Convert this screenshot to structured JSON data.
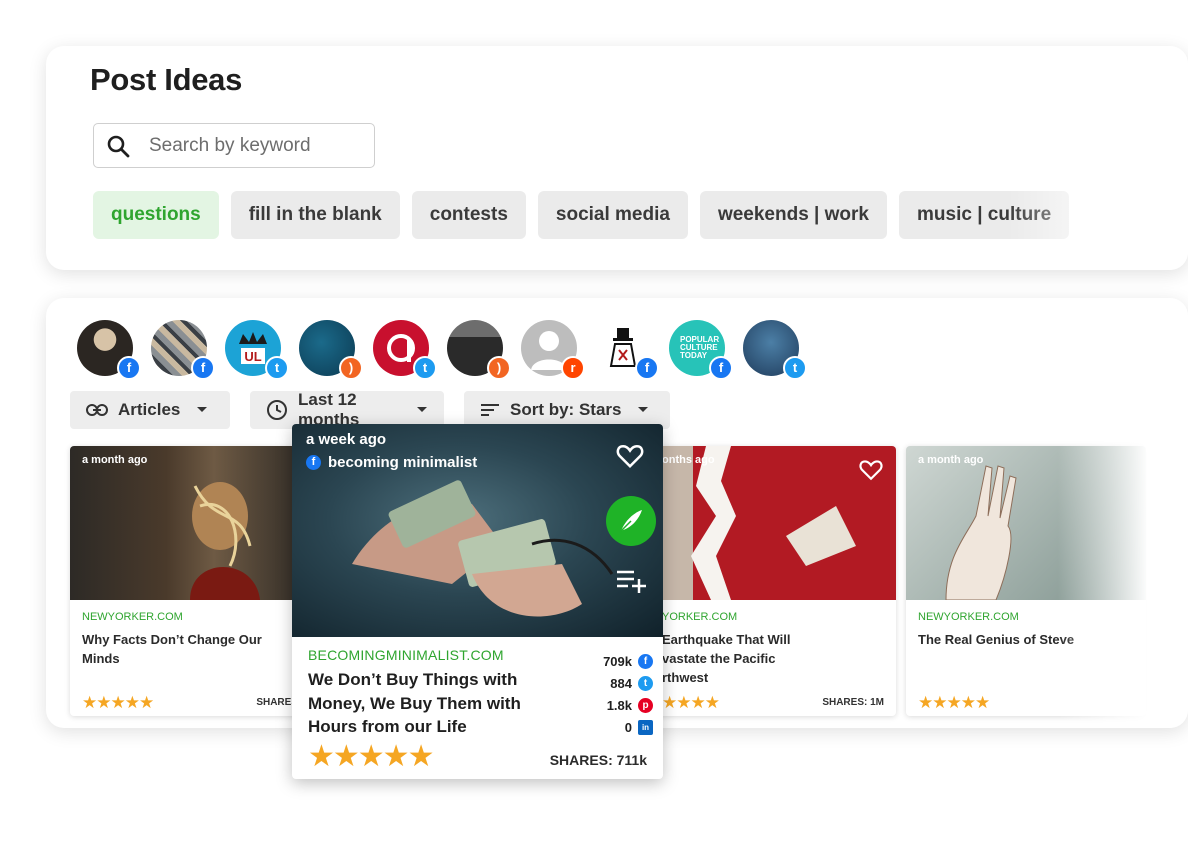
{
  "header": {
    "title": "Post Ideas",
    "search_placeholder": "Search by keyword"
  },
  "chips": [
    {
      "label": "questions",
      "active": true
    },
    {
      "label": "fill in the blank",
      "active": false
    },
    {
      "label": "contests",
      "active": false
    },
    {
      "label": "social media",
      "active": false
    },
    {
      "label": "weekends | work",
      "active": false
    },
    {
      "label": "music | culture",
      "active": false
    }
  ],
  "sources": [
    {
      "network": "facebook",
      "icon": "facebook-icon"
    },
    {
      "network": "facebook",
      "icon": "facebook-icon"
    },
    {
      "network": "twitter",
      "icon": "twitter-icon"
    },
    {
      "network": "rss",
      "icon": "rss-icon"
    },
    {
      "network": "twitter",
      "icon": "twitter-icon"
    },
    {
      "network": "rss",
      "icon": "rss-icon"
    },
    {
      "network": "reddit",
      "icon": "reddit-icon"
    },
    {
      "network": "facebook",
      "icon": "facebook-icon"
    },
    {
      "network": "facebook",
      "icon": "facebook-icon",
      "avatar_text": "POPULAR CULTURE TODAY"
    },
    {
      "network": "twitter",
      "icon": "twitter-icon"
    }
  ],
  "filters": {
    "type": "Articles",
    "range": "Last 12 months",
    "sort": "Sort by: Stars"
  },
  "cards": [
    {
      "ago": "a month ago",
      "domain": "NEWYORKER.COM",
      "headline": "Why Facts Don’t Change Our Minds",
      "stars": "★★★★★",
      "shares": "SHARES"
    },
    {
      "ago": "onths ago",
      "domain": "YORKER.COM",
      "headline": "Earthquake That Will vastate the Pacific rthwest",
      "stars": "★★★★",
      "shares": "SHARES: 1M"
    },
    {
      "ago": "a month ago",
      "domain": "NEWYORKER.COM",
      "headline": "The Real Genius of Steve",
      "stars": "★★★★★",
      "shares": ""
    }
  ],
  "featured": {
    "ago": "a week ago",
    "source": "becoming minimalist",
    "domain": "BECOMINGMINIMALIST.COM",
    "headline": "We Don’t Buy Things with Money, We Buy Them with Hours from our Life",
    "stats": [
      {
        "value": "709k",
        "network": "facebook",
        "icon_char": "f",
        "color": "#1877f2"
      },
      {
        "value": "884",
        "network": "twitter",
        "icon_char": "t",
        "color": "#1d9bf0"
      },
      {
        "value": "1.8k",
        "network": "pinterest",
        "icon_char": "p",
        "color": "#e60023"
      },
      {
        "value": "0",
        "network": "linkedin",
        "icon_char": "in",
        "color": "#0a66c2"
      }
    ],
    "stars": "★★★★★",
    "shares": "SHARES: 711k"
  },
  "colors": {
    "accent_green": "#2fa52f",
    "star": "#f5a623",
    "chip_bg": "#ebebeb"
  }
}
